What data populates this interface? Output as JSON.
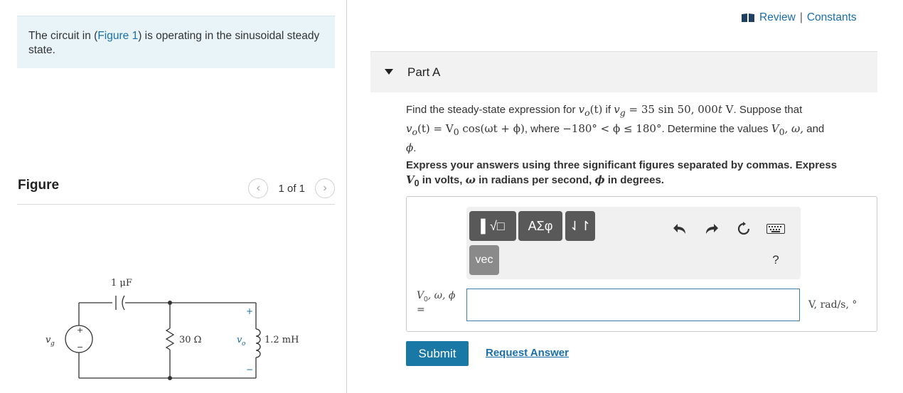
{
  "intro": {
    "text_before": "The circuit in (",
    "figure_link": "Figure 1",
    "text_after": ") is operating in the sinusoidal steady state."
  },
  "figure": {
    "title": "Figure",
    "pager": "1 of 1",
    "labels": {
      "capacitor": "1 μF",
      "resistor": "30 Ω",
      "inductor": "1.2 mH",
      "source": "v",
      "source_sub": "g",
      "output": "v",
      "output_sub": "o",
      "plus": "+",
      "minus": "−"
    }
  },
  "header": {
    "review": "Review",
    "sep": " | ",
    "constants": "Constants"
  },
  "part": {
    "title": "Part A"
  },
  "question": {
    "t1": "Find the steady-state expression for ",
    "vo_t": "v",
    "vo_sub": "o",
    "vo_arg": "(t)",
    "t2": " if ",
    "vg": "v",
    "vg_sub": "g",
    "vg_expr": " = 35 sin 50, 000",
    "vg_t": "t",
    "vg_unit": " V",
    "t3": ". Suppose that",
    "line2_a": "v",
    "line2_a_sub": "o",
    "line2_b": "(t) = V",
    "line2_b_sub": "0",
    "line2_c": " cos(ωt + ϕ)",
    "t4": ", where ",
    "range": "−180° < ϕ ≤ 180°",
    "t5": ". Determine the values ",
    "vals_v": "V",
    "vals_v_sub": "0",
    "vals_rest": ", ω,",
    "t6": " and",
    "phi_end": "ϕ",
    "period": "."
  },
  "instructions": {
    "l1": "Express your answers using three significant figures separated by commas. Express",
    "v0": "V",
    "v0_sub": "0",
    "l2a": " in volts, ",
    "omega": "ω",
    "l2b": " in radians per second, ",
    "phi": "ϕ",
    "l2c": " in degrees."
  },
  "toolbar": {
    "templates": "▌√□",
    "greek": "ΑΣφ",
    "arrows": "⇃↾",
    "vec": "vec",
    "help": "?"
  },
  "answer": {
    "label_v": "V",
    "label_sub": "0",
    "label_rest": ", ω, ϕ",
    "equals": "=",
    "value": "",
    "units": "V, rad/s, °"
  },
  "actions": {
    "submit": "Submit",
    "request": "Request Answer"
  },
  "colors": {
    "link": "#1a6fa8",
    "submit_bg": "#1a78a7",
    "intro_bg": "#e8f4f7",
    "toolbar_btn": "#595959"
  }
}
